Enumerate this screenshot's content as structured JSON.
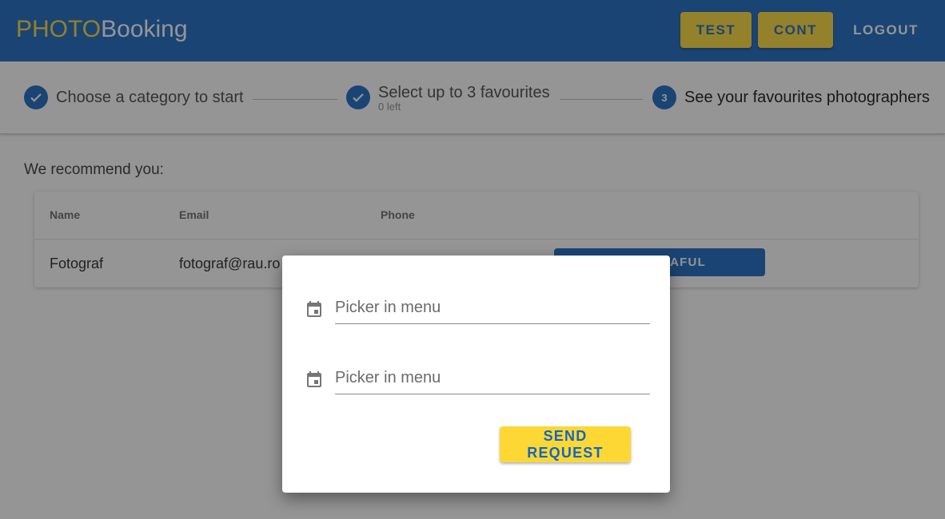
{
  "header": {
    "logo_part1": "PHOTO",
    "logo_part2": "Booking",
    "test_label": "TEST",
    "cont_label": "CONT",
    "logout_label": "LOGOUT"
  },
  "stepper": {
    "steps": [
      {
        "label": "Choose a category to start",
        "state": "complete",
        "icon": "check-icon"
      },
      {
        "label": "Select up to 3 favourites",
        "sublabel": "0 left",
        "state": "complete",
        "icon": "check-icon"
      },
      {
        "label": "See your favourites photographers",
        "number": "3",
        "state": "active"
      }
    ]
  },
  "main": {
    "title": "We recommend you:",
    "table": {
      "headers": [
        "Name",
        "Email",
        "Phone"
      ],
      "rows": [
        {
          "name": "Fotograf",
          "email": "fotograf@rau.ro",
          "action": "FOTOGRAFUL"
        }
      ]
    }
  },
  "dialog": {
    "fields": [
      {
        "placeholder": "Picker in menu",
        "icon": "calendar-icon"
      },
      {
        "placeholder": "Picker in menu",
        "icon": "calendar-icon"
      }
    ],
    "send_label": "SEND REQUEST"
  },
  "colors": {
    "primary": "#1565c0",
    "accent": "#fdd835"
  }
}
